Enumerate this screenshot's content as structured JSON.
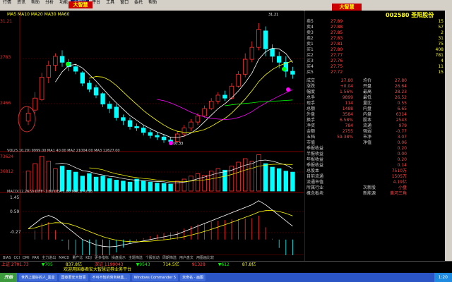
{
  "menu": [
    "行情",
    "资讯",
    "帮助",
    "分析",
    "功能",
    "大智慧",
    "平台",
    "工具",
    "窗口",
    "委托",
    "帮助"
  ],
  "menu_active": 5,
  "logo": "大智慧",
  "logo2": "大智慧",
  "chart_info": {
    "main_header": "MA5 MA10 MA20 MA30 MA60",
    "y_high": "31.21",
    "y_mid1": "2783",
    "y_mid2": "2466",
    "peak_label": "31.21",
    "low_label": "10.33",
    "vol_header": "VOL(5,10,20) 9999.00 MA1 40.00 MA2 21004.00 MA3 12627.00",
    "vol_y1": "73624",
    "vol_y2": "36812",
    "macd_header": "MACD(12,26,9) DIFF -1.80 DEA 1.80 MACD -0.18",
    "macd_y1": "1.45",
    "macd_y2": "0.59",
    "macd_y3": "-0.27"
  },
  "bottom_tabs": [
    "BIAS",
    "CCI",
    "DMI",
    "PAR",
    "主力进出",
    "MACD",
    "量产比",
    "KDJ",
    "更多指标",
    "操盘提示",
    "主题筛选",
    "个股轮动",
    "周期筛选",
    "用户盘文",
    "用图画比较"
  ],
  "stock": {
    "code": "002580",
    "name": "圣阳股份"
  },
  "order_book": [
    {
      "label": "卖5",
      "price": "27.89",
      "vol": "15"
    },
    {
      "label": "卖4",
      "price": "27.88",
      "vol": "57"
    },
    {
      "label": "卖3",
      "price": "27.85",
      "vol": "2"
    },
    {
      "label": "卖2",
      "price": "27.83",
      "vol": "31"
    },
    {
      "label": "卖1",
      "price": "27.81",
      "vol": "75"
    },
    {
      "label": "买1",
      "price": "27.80",
      "vol": "408"
    },
    {
      "label": "买2",
      "price": "27.77",
      "vol": "781"
    },
    {
      "label": "买3",
      "price": "27.76",
      "vol": "4"
    },
    {
      "label": "买4",
      "price": "27.75",
      "vol": "11"
    },
    {
      "label": "买5",
      "price": "27.72",
      "vol": "15"
    }
  ],
  "stats": [
    {
      "a": "成交",
      "b": "27.80",
      "c": "均价",
      "d": "27.80"
    },
    {
      "a": "涨跌",
      "b": "+0.04",
      "c": "开盘",
      "d": "26.64"
    },
    {
      "a": "幅度",
      "b": "1.56%",
      "c": "最高",
      "d": "28.23"
    },
    {
      "a": "总手",
      "b": "9899",
      "c": "最低",
      "d": "26.52"
    },
    {
      "a": "现手",
      "b": "114",
      "c": "量比",
      "d": "0.55"
    },
    {
      "a": "总额",
      "b": "1488",
      "c": "内盘",
      "d": "6.65"
    },
    {
      "a": "外盘",
      "b": "3584",
      "c": "内盘",
      "d": "6314"
    },
    {
      "a": "换手",
      "b": "6.58%",
      "c": "股本",
      "d": "2543"
    },
    {
      "a": "净资",
      "b": "784",
      "c": "流通",
      "d": "979"
    },
    {
      "a": "金额",
      "b": "2755",
      "c": "强弱",
      "d": "-0.77"
    },
    {
      "a": "五档",
      "b": "59.38%",
      "c": "市净",
      "d": "3.07"
    },
    {
      "a": "市值",
      "b": "",
      "c": "净值",
      "d": "0.06"
    },
    {
      "a": "季报收益",
      "b": "",
      "c": "",
      "d": "0.20"
    },
    {
      "a": "半报收益",
      "b": "",
      "c": "",
      "d": "0.00"
    },
    {
      "a": "年报收益",
      "b": "",
      "c": "",
      "d": "0.20"
    },
    {
      "a": "季报收益",
      "b": "",
      "c": "",
      "d": "0.14"
    },
    {
      "a": "总股本",
      "b": "",
      "c": "",
      "d": "7510万"
    },
    {
      "a": "目前流通",
      "b": "",
      "c": "",
      "d": "1505万"
    },
    {
      "a": "流通市值",
      "b": "",
      "c": "",
      "d": "4.19亿"
    },
    {
      "a": "所属行业",
      "b": "",
      "c": "次新股",
      "d": "小盘"
    },
    {
      "a": "概念板块",
      "b": "",
      "c": "新能源",
      "d": "黄河三角"
    }
  ],
  "ticker": [
    {
      "label": "上证",
      "value": "2701.73",
      "color": "#f44"
    },
    {
      "label": "",
      "value": "▼705",
      "color": "#0f0"
    },
    {
      "label": "",
      "value": "837.8亿",
      "color": "#ff0"
    },
    {
      "label": "深证",
      "value": "1199043",
      "color": "#f44"
    },
    {
      "label": "",
      "value": "▼9543",
      "color": "#0f0"
    },
    {
      "label": "",
      "value": "714.5亿",
      "color": "#ff0"
    },
    {
      "label": "",
      "value": "91328",
      "color": "#f44"
    },
    {
      "label": "",
      "value": "▼612",
      "color": "#0f0"
    },
    {
      "label": "",
      "value": "87.8亿",
      "color": "#ff0"
    }
  ],
  "scroll_text": "欢迎用国泰君安大智慧证券业务平台",
  "taskbar": {
    "start": "开始",
    "tasks": [
      "世界上最好的人_黑皇",
      "国泰君安大智慧",
      "不可不知的劳务续集…",
      "Windows Commander 5",
      "未命名 - 画图"
    ],
    "tray": "1:20"
  },
  "candles": [
    {
      "o": 2466,
      "c": 2520,
      "h": 2560,
      "l": 2440
    },
    {
      "o": 2540,
      "c": 2620,
      "h": 2660,
      "l": 2520
    },
    {
      "o": 2610,
      "c": 2760,
      "h": 2790,
      "l": 2600
    },
    {
      "o": 2760,
      "c": 2840,
      "h": 2870,
      "l": 2720
    },
    {
      "o": 2840,
      "c": 2900,
      "h": 2920,
      "l": 2800
    },
    {
      "o": 2900,
      "c": 2860,
      "h": 2940,
      "l": 2830
    },
    {
      "o": 2860,
      "c": 2830,
      "h": 2880,
      "l": 2800
    },
    {
      "o": 2830,
      "c": 2800,
      "h": 2850,
      "l": 2780
    },
    {
      "o": 2790,
      "c": 2720,
      "h": 2800,
      "l": 2700
    },
    {
      "o": 2720,
      "c": 2680,
      "h": 2740,
      "l": 2660
    },
    {
      "o": 2690,
      "c": 2640,
      "h": 2710,
      "l": 2620
    },
    {
      "o": 2650,
      "c": 2580,
      "h": 2660,
      "l": 2560
    },
    {
      "o": 2580,
      "c": 2550,
      "h": 2600,
      "l": 2520
    },
    {
      "o": 2560,
      "c": 2490,
      "h": 2580,
      "l": 2470
    },
    {
      "o": 2490,
      "c": 2470,
      "h": 2510,
      "l": 2440
    },
    {
      "o": 2470,
      "c": 2430,
      "h": 2490,
      "l": 2410
    },
    {
      "o": 2430,
      "c": 2420,
      "h": 2450,
      "l": 2400
    },
    {
      "o": 2420,
      "c": 2390,
      "h": 2440,
      "l": 2370
    },
    {
      "o": 2390,
      "c": 2370,
      "h": 2410,
      "l": 2350
    },
    {
      "o": 2370,
      "c": 2360,
      "h": 2390,
      "l": 2340
    },
    {
      "o": 2360,
      "c": 2340,
      "h": 2380,
      "l": 2320
    },
    {
      "o": 2340,
      "c": 2330,
      "h": 2360,
      "l": 2310
    },
    {
      "o": 2330,
      "c": 2380,
      "h": 2400,
      "l": 2320
    },
    {
      "o": 2380,
      "c": 2420,
      "h": 2440,
      "l": 2360
    },
    {
      "o": 2420,
      "c": 2460,
      "h": 2480,
      "l": 2400
    },
    {
      "o": 2460,
      "c": 2500,
      "h": 2520,
      "l": 2440
    },
    {
      "o": 2500,
      "c": 2550,
      "h": 2570,
      "l": 2490
    },
    {
      "o": 2550,
      "c": 2600,
      "h": 2620,
      "l": 2540
    },
    {
      "o": 2600,
      "c": 2640,
      "h": 2660,
      "l": 2580
    },
    {
      "o": 2640,
      "c": 2620,
      "h": 2670,
      "l": 2600
    },
    {
      "o": 2620,
      "c": 2700,
      "h": 2720,
      "l": 2610
    },
    {
      "o": 2700,
      "c": 2780,
      "h": 2800,
      "l": 2690
    },
    {
      "o": 2780,
      "c": 2880,
      "h": 2920,
      "l": 2760
    },
    {
      "o": 2880,
      "c": 2960,
      "h": 3000,
      "l": 2860
    },
    {
      "o": 2960,
      "c": 3080,
      "h": 3121,
      "l": 2940
    },
    {
      "o": 3070,
      "c": 2950,
      "h": 3100,
      "l": 2900
    },
    {
      "o": 2950,
      "c": 2900,
      "h": 2980,
      "l": 2860
    },
    {
      "o": 2900,
      "c": 2860,
      "h": 2930,
      "l": 2820
    },
    {
      "o": 2860,
      "c": 2800,
      "h": 2900,
      "l": 2760
    },
    {
      "o": 2800,
      "c": 2780,
      "h": 2830,
      "l": 2750
    }
  ],
  "volumes": [
    40,
    55,
    70,
    60,
    45,
    50,
    42,
    38,
    30,
    35,
    28,
    30,
    25,
    22,
    20,
    18,
    24,
    20,
    18,
    16,
    15,
    14,
    20,
    24,
    30,
    35,
    32,
    40,
    45,
    42,
    50,
    58,
    65,
    60,
    73,
    55,
    48,
    45,
    40,
    38
  ],
  "macd": [
    0.4,
    0.6,
    0.8,
    0.9,
    0.8,
    0.6,
    0.4,
    0.2,
    0.0,
    -0.1,
    -0.2,
    -0.25,
    -0.27,
    -0.25,
    -0.2,
    -0.15,
    -0.1,
    -0.05,
    0.0,
    0.05,
    0.1,
    0.15,
    0.2,
    0.3,
    0.4,
    0.5,
    0.6,
    0.7,
    0.8,
    0.9,
    1.0,
    1.1,
    1.2,
    1.3,
    1.45,
    1.3,
    1.1,
    0.9,
    0.7,
    0.5
  ]
}
